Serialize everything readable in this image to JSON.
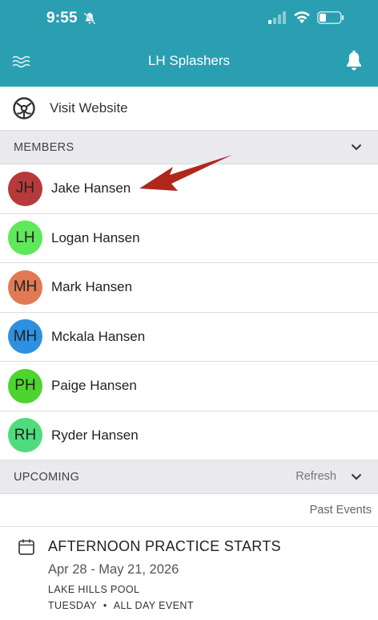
{
  "status_bar": {
    "time": "9:55"
  },
  "nav": {
    "title": "LH Splashers"
  },
  "visit": {
    "label": "Visit Website"
  },
  "members": {
    "header": "MEMBERS",
    "items": [
      {
        "initials": "JH",
        "name": "Jake Hansen",
        "color": "#b73a3a"
      },
      {
        "initials": "LH",
        "name": "Logan Hansen",
        "color": "#5ee85a"
      },
      {
        "initials": "MH",
        "name": "Mark Hansen",
        "color": "#e07a55"
      },
      {
        "initials": "MH",
        "name": "Mckala Hansen",
        "color": "#2e90e0"
      },
      {
        "initials": "PH",
        "name": "Paige Hansen",
        "color": "#4ed42e"
      },
      {
        "initials": "RH",
        "name": "Ryder Hansen",
        "color": "#4fdc7c"
      }
    ]
  },
  "upcoming": {
    "header": "UPCOMING",
    "refresh": "Refresh",
    "past_events": "Past Events",
    "event": {
      "title": "AFTERNOON PRACTICE STARTS",
      "dates": "Apr 28 - May 21, 2026",
      "location": "LAKE HILLS POOL",
      "day": "TUESDAY",
      "separator": "•",
      "kind": "ALL DAY EVENT"
    }
  },
  "colors": {
    "brand": "#2a9fb1",
    "arrow": "#b0281c"
  }
}
